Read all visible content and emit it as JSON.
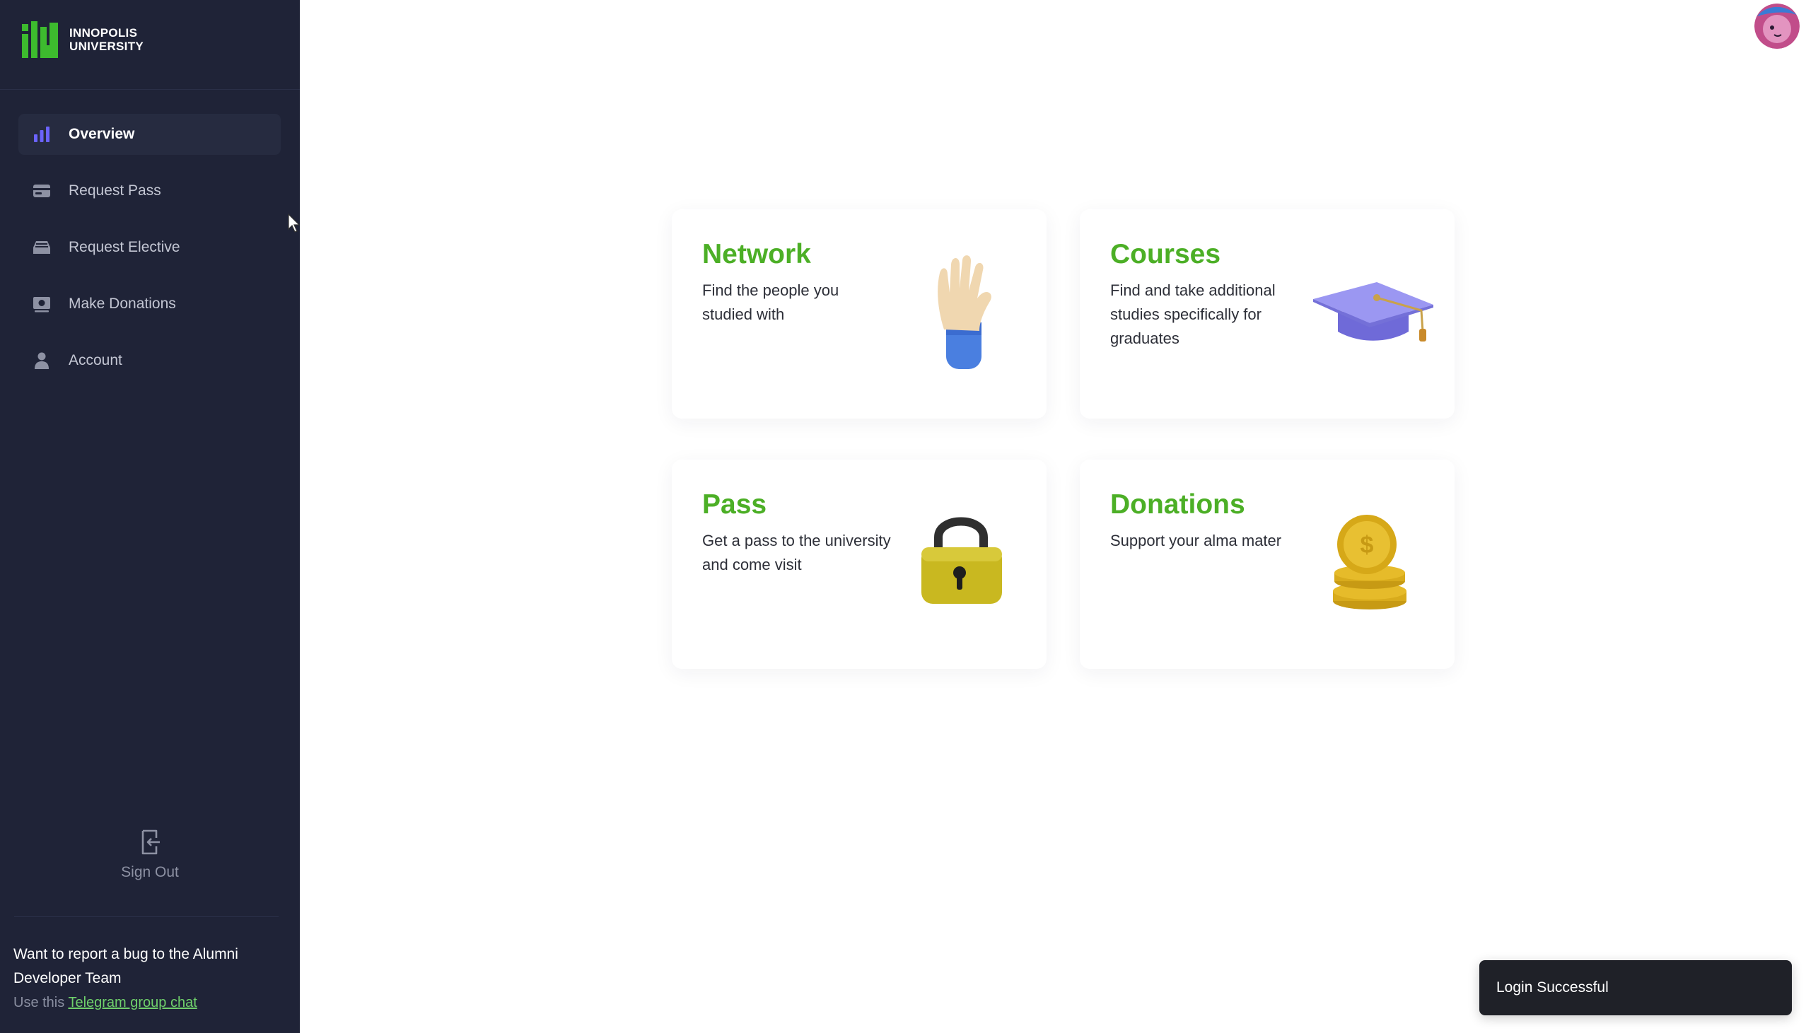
{
  "brand": {
    "line1": "INNOPOLIS",
    "line2": "UNIVERSITY",
    "logo_icon": "innopolis-logo"
  },
  "sidebar": {
    "items": [
      {
        "label": "Overview",
        "icon": "bar-chart-icon",
        "active": true
      },
      {
        "label": "Request Pass",
        "icon": "card-icon",
        "active": false
      },
      {
        "label": "Request Elective",
        "icon": "inbox-icon",
        "active": false
      },
      {
        "label": "Make Donations",
        "icon": "donation-icon",
        "active": false
      },
      {
        "label": "Account",
        "icon": "user-icon",
        "active": false
      }
    ],
    "sign_out": "Sign Out",
    "bug_report": {
      "text": "Want to report a bug to the Alumni Developer Team",
      "hint_prefix": "Use this",
      "link_text": "Telegram group chat"
    }
  },
  "cards": [
    {
      "title": "Network",
      "description": "Find the people you studied with",
      "icon": "waving-hand-icon"
    },
    {
      "title": "Courses",
      "description": "Find and take additional studies specifically for graduates",
      "icon": "graduation-cap-icon"
    },
    {
      "title": "Pass",
      "description": "Get a pass to the university and come visit",
      "icon": "padlock-icon"
    },
    {
      "title": "Donations",
      "description": "Support your alma mater",
      "icon": "coin-stack-icon"
    }
  ],
  "toast": {
    "message": "Login Successful"
  },
  "colors": {
    "sidebar_bg": "#1f2337",
    "accent_green": "#4caf26",
    "active_icon": "#6b63ff"
  }
}
